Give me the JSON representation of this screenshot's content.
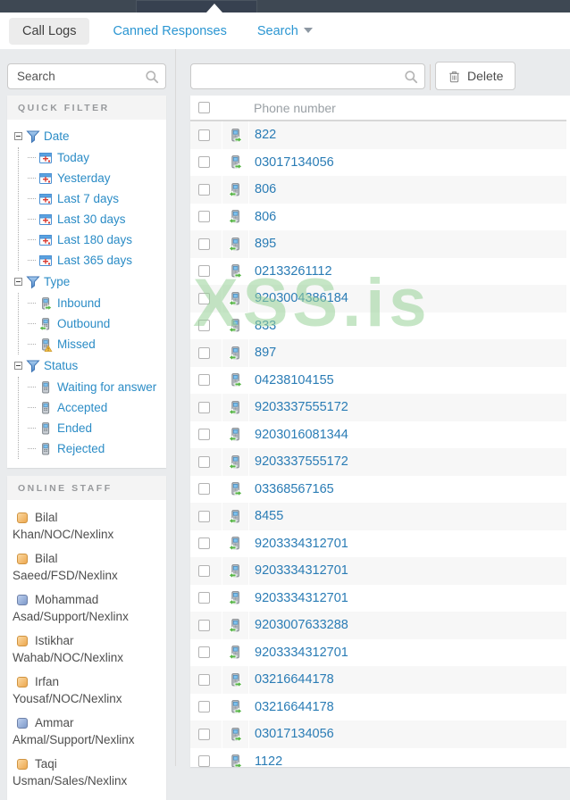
{
  "tabs": {
    "call_logs": "Call Logs",
    "canned_responses": "Canned Responses",
    "search": "Search"
  },
  "sidebar": {
    "search_placeholder": "Search",
    "quick_filter": {
      "title": "QUICK FILTER",
      "groups": [
        {
          "label": "Date",
          "icon": "funnel",
          "children": [
            {
              "label": "Today",
              "icon": "calendar"
            },
            {
              "label": "Yesterday",
              "icon": "calendar"
            },
            {
              "label": "Last 7 days",
              "icon": "calendar"
            },
            {
              "label": "Last 30 days",
              "icon": "calendar"
            },
            {
              "label": "Last 180 days",
              "icon": "calendar"
            },
            {
              "label": "Last 365 days",
              "icon": "calendar"
            }
          ]
        },
        {
          "label": "Type",
          "icon": "funnel",
          "children": [
            {
              "label": "Inbound",
              "icon": "phone-in"
            },
            {
              "label": "Outbound",
              "icon": "phone-out"
            },
            {
              "label": "Missed",
              "icon": "phone-missed"
            }
          ]
        },
        {
          "label": "Status",
          "icon": "funnel",
          "children": [
            {
              "label": "Waiting for answer",
              "icon": "phone-plain"
            },
            {
              "label": "Accepted",
              "icon": "phone-plain"
            },
            {
              "label": "Ended",
              "icon": "phone-plain"
            },
            {
              "label": "Rejected",
              "icon": "phone-plain"
            }
          ]
        }
      ]
    },
    "online_staff": {
      "title": "ONLINE STAFF",
      "members": [
        {
          "name": "Bilal Khan/NOC/Nexlinx",
          "color": "orange"
        },
        {
          "name": "Bilal Saeed/FSD/Nexlinx",
          "color": "orange"
        },
        {
          "name": "Mohammad Asad/Support/Nexlinx",
          "color": "blue"
        },
        {
          "name": "Istikhar Wahab/NOC/Nexlinx",
          "color": "orange"
        },
        {
          "name": "Irfan Yousaf/NOC/Nexlinx",
          "color": "orange"
        },
        {
          "name": "Ammar Akmal/Support/Nexlinx",
          "color": "blue"
        },
        {
          "name": "Taqi Usman/Sales/Nexlinx",
          "color": "orange"
        }
      ]
    }
  },
  "toolbar": {
    "search_value": "",
    "delete_label": "Delete"
  },
  "table": {
    "header": "Phone number",
    "rows": [
      {
        "phone": "822",
        "type": "inbound"
      },
      {
        "phone": "03017134056",
        "type": "inbound"
      },
      {
        "phone": "806",
        "type": "outbound"
      },
      {
        "phone": "806",
        "type": "outbound"
      },
      {
        "phone": "895",
        "type": "outbound"
      },
      {
        "phone": "02133261112",
        "type": "inbound"
      },
      {
        "phone": "9203004386184",
        "type": "outbound"
      },
      {
        "phone": "833",
        "type": "outbound"
      },
      {
        "phone": "897",
        "type": "outbound"
      },
      {
        "phone": "04238104155",
        "type": "inbound"
      },
      {
        "phone": "9203337555172",
        "type": "outbound"
      },
      {
        "phone": "9203016081344",
        "type": "outbound"
      },
      {
        "phone": "9203337555172",
        "type": "outbound"
      },
      {
        "phone": "03368567165",
        "type": "inbound"
      },
      {
        "phone": "8455",
        "type": "outbound"
      },
      {
        "phone": "9203334312701",
        "type": "outbound"
      },
      {
        "phone": "9203334312701",
        "type": "outbound"
      },
      {
        "phone": "9203334312701",
        "type": "outbound"
      },
      {
        "phone": "9203007633288",
        "type": "outbound"
      },
      {
        "phone": "9203334312701",
        "type": "outbound"
      },
      {
        "phone": "03216644178",
        "type": "inbound"
      },
      {
        "phone": "03216644178",
        "type": "inbound"
      },
      {
        "phone": "03017134056",
        "type": "inbound"
      },
      {
        "phone": "1122",
        "type": "inbound"
      }
    ]
  },
  "watermark": "XSS.is",
  "colors": {
    "topbar": "#3e4853",
    "link_blue": "#2b8cc6",
    "phone_link": "#2a7cb5",
    "stripe": "#f7f7f7",
    "staff_orange": "#eda850",
    "staff_blue": "#7e9aca",
    "watermark_green": "#97d197"
  }
}
